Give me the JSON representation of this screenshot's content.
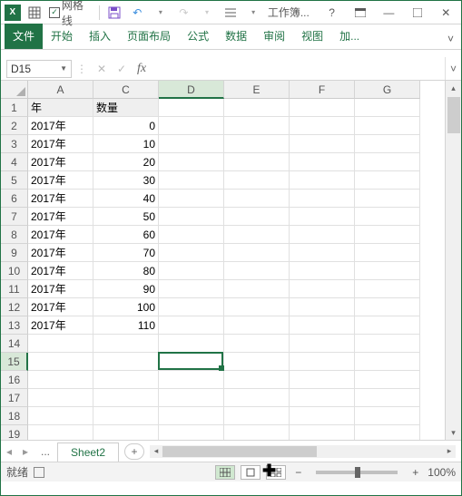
{
  "titlebar": {
    "gridlines_label": "网格线",
    "gridlines_checked": true,
    "workbook_title": "工作簿...",
    "help": "?"
  },
  "ribbon": {
    "file": "文件",
    "home": "开始",
    "insert": "插入",
    "layout": "页面布局",
    "formula": "公式",
    "data": "数据",
    "review": "审阅",
    "view": "视图",
    "add": "加..."
  },
  "formula_bar": {
    "name_box": "D15",
    "fx": "fx"
  },
  "columns": [
    "A",
    "C",
    "D",
    "E",
    "F",
    "G"
  ],
  "rows": [
    1,
    2,
    3,
    4,
    5,
    6,
    7,
    8,
    9,
    10,
    11,
    12,
    13,
    14,
    15,
    16,
    17,
    18,
    19
  ],
  "headers": {
    "A": "年",
    "C": "数量"
  },
  "data": [
    {
      "A": "2017年",
      "C": "0"
    },
    {
      "A": "2017年",
      "C": "10"
    },
    {
      "A": "2017年",
      "C": "20"
    },
    {
      "A": "2017年",
      "C": "30"
    },
    {
      "A": "2017年",
      "C": "40"
    },
    {
      "A": "2017年",
      "C": "50"
    },
    {
      "A": "2017年",
      "C": "60"
    },
    {
      "A": "2017年",
      "C": "70"
    },
    {
      "A": "2017年",
      "C": "80"
    },
    {
      "A": "2017年",
      "C": "90"
    },
    {
      "A": "2017年",
      "C": "100"
    },
    {
      "A": "2017年",
      "C": "110"
    }
  ],
  "selected_cell": "D15",
  "sheet_tabs": {
    "active": "Sheet2",
    "dots": "..."
  },
  "status": {
    "ready": "就绪",
    "zoom": "100%",
    "minus": "−",
    "plus": "+"
  }
}
